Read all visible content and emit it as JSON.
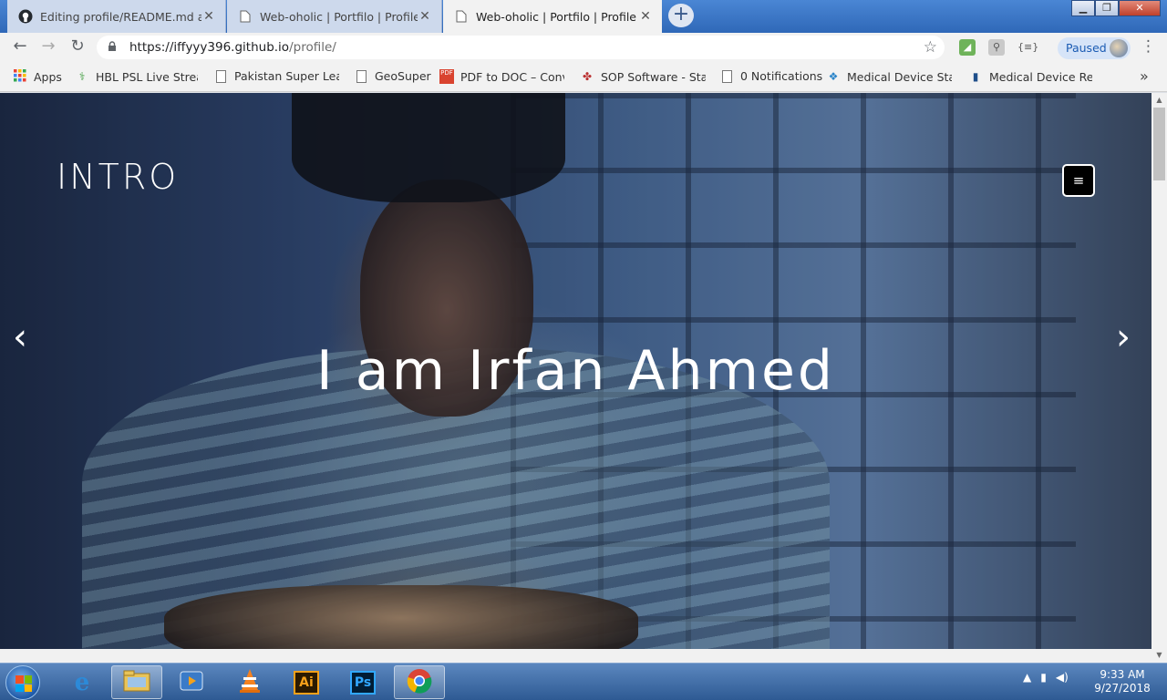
{
  "tabs": [
    {
      "title": "Editing profile/README.md at m",
      "close": "✕",
      "active": false
    },
    {
      "title": "Web-oholic | Portfilo | Profile",
      "close": "✕",
      "active": false
    },
    {
      "title": "Web-oholic | Portfilo | Profile",
      "close": "✕",
      "active": true
    }
  ],
  "window_controls": {
    "minimize": "▁",
    "restore": "❐",
    "close": "✕"
  },
  "toolbar": {
    "back": "←",
    "forward": "→",
    "reload": "↻",
    "url_host": "https://iffyyy396.github.io",
    "url_path": "/profile/",
    "star": "☆",
    "profile_status": "Paused",
    "menu": "⋮"
  },
  "bookmarks": [
    {
      "label": "Apps",
      "icon": "apps-grid-icon"
    },
    {
      "label": "HBL PSL Live Streami",
      "icon": "psl-icon"
    },
    {
      "label": "Pakistan Super Leagu",
      "icon": "page-icon"
    },
    {
      "label": "GeoSuper",
      "icon": "page-icon"
    },
    {
      "label": "PDF to DOC – Conver",
      "icon": "pdf-icon"
    },
    {
      "label": "SOP Software - Stanc",
      "icon": "sop-icon"
    },
    {
      "label": "0 Notifications",
      "icon": "page-icon"
    },
    {
      "label": "Medical Device Stanc",
      "icon": "device-icon"
    },
    {
      "label": "Medical Device Repo",
      "icon": "report-icon"
    }
  ],
  "bookmarks_more": "»",
  "page": {
    "intro": "INTRO",
    "hero": "I am Irfan Ahmed",
    "menu_icon": "≡",
    "prev": "‹",
    "next": "›"
  },
  "taskbar": {
    "apps": [
      {
        "name": "ie",
        "label": "e"
      },
      {
        "name": "explorer",
        "label": ""
      },
      {
        "name": "media",
        "label": ""
      },
      {
        "name": "vlc",
        "label": ""
      },
      {
        "name": "illustrator",
        "label": "Ai"
      },
      {
        "name": "photoshop",
        "label": "Ps"
      },
      {
        "name": "chrome",
        "label": ""
      }
    ],
    "time": "9:33 AM",
    "date": "9/27/2018"
  }
}
